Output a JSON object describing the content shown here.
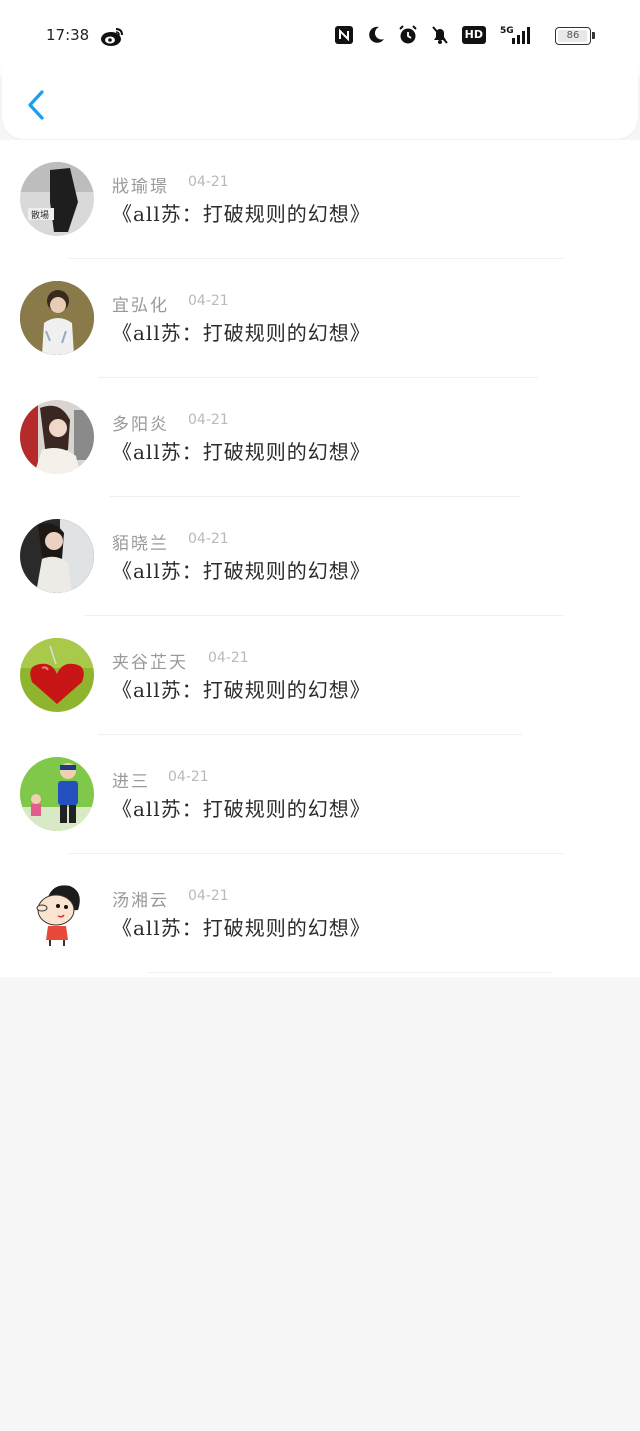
{
  "status_bar": {
    "time": "17:38",
    "battery_level": "86",
    "icons": [
      "weibo-icon",
      "nfc-icon",
      "moon-icon",
      "alarm-icon",
      "bell-off-icon",
      "hd-icon",
      "signal-5g-icon",
      "battery-icon"
    ],
    "hd_label": "HD"
  },
  "header": {
    "back_icon": "chevron-left-icon",
    "accent_color": "#1a9ef0"
  },
  "items": [
    {
      "name": "戕瑜璟",
      "date": "04-21",
      "message": "《all苏：打破规则的幻想》"
    },
    {
      "name": "宜弘化",
      "date": "04-21",
      "message": "《all苏：打破规则的幻想》"
    },
    {
      "name": "多阳炎",
      "date": "04-21",
      "message": "《all苏：打破规则的幻想》"
    },
    {
      "name": "貊晓兰",
      "date": "04-21",
      "message": "《all苏：打破规则的幻想》"
    },
    {
      "name": "夹谷芷天",
      "date": "04-21",
      "message": "《all苏：打破规则的幻想》"
    },
    {
      "name": "进三",
      "date": "04-21",
      "message": "《all苏：打破规则的幻想》"
    },
    {
      "name": "汤湘云",
      "date": "04-21",
      "message": "《all苏：打破规则的幻想》"
    }
  ]
}
